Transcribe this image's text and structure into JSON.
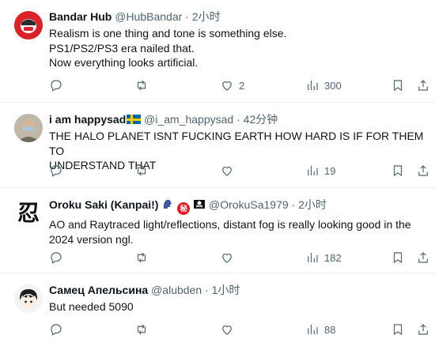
{
  "colors": {
    "text": "#0f1419",
    "muted": "#536471",
    "divider": "#eff3f4"
  },
  "tweets": [
    {
      "name": "Bandar Hub",
      "handle": "@HubBandar",
      "dot": "·",
      "time": "2小时",
      "lines": [
        "Realism is one thing and tone is something else.",
        "PS1/PS2/PS3 era nailed that.",
        "Now everything looks artificial."
      ],
      "like_count": "2",
      "view_count": "300"
    },
    {
      "name": "i am happysad",
      "handle": "@i_am_happysad",
      "dot": "·",
      "time": "42分钟",
      "lines": [
        "THE HALO PLANET ISNT FUCKING EARTH HOW HARD IS IF FOR THEM TO",
        "UNDERSTAND THAT"
      ],
      "view_count": "19"
    },
    {
      "name": "Oroku Saki (Kanpai!)",
      "handle": "@OrokuSa1979",
      "dot": "·",
      "time": "2小时",
      "lines": [
        "AO and Raytraced light/reflections, distant fog is really looking good in the",
        "2024 version ngl."
      ],
      "view_count": "182",
      "avatar_glyph": "忍",
      "badge_glyph": "秘"
    },
    {
      "name": "Самец Апельсина",
      "handle": "@alubden",
      "dot": "·",
      "time": "1小时",
      "lines": [
        "But needed 5090"
      ],
      "view_count": "88"
    }
  ]
}
